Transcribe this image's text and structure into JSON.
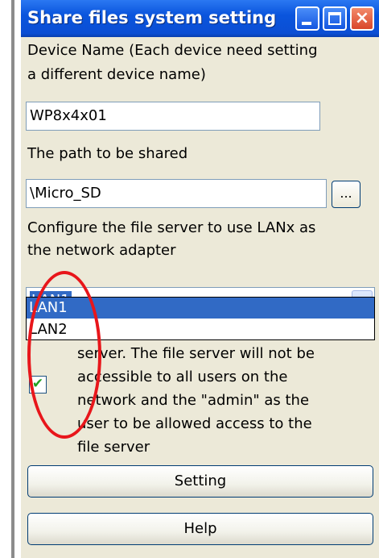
{
  "window": {
    "title": "Share files system setting"
  },
  "device_name": {
    "label_line1": "Device Name (Each device need setting",
    "label_line2": "a different device name)",
    "value": "WP8x4x01"
  },
  "shared_path": {
    "label": "The path to be shared",
    "value": "\\Micro_SD",
    "browse_label": "..."
  },
  "adapter": {
    "label_line1": "Configure the file server to use LANx as",
    "label_line2": "the network adapter",
    "selected": "LAN1",
    "options": [
      "LAN1",
      "LAN2"
    ]
  },
  "security_option": {
    "lines": [
      "server. The file server will not be",
      "accessible to all users on the",
      "network and the \"admin\" as the",
      "user to be allowed access to the",
      "file server"
    ],
    "checked": true
  },
  "buttons": {
    "setting": "Setting",
    "help": "Help"
  },
  "colors": {
    "titlebar": "#0b4ed4",
    "selection": "#316ac5",
    "annotation": "#e8161b"
  }
}
